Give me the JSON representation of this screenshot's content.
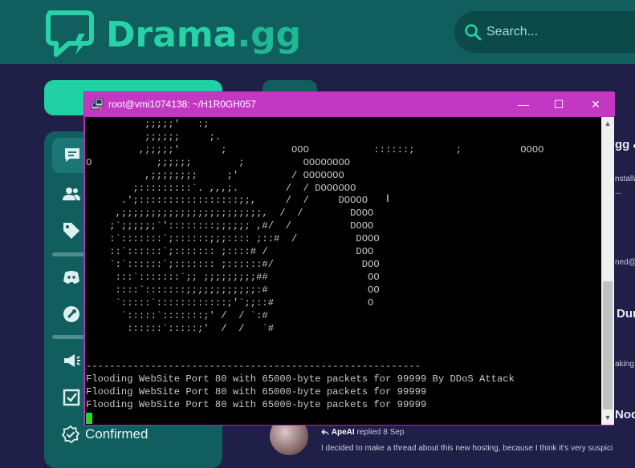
{
  "site": {
    "logo_main": "Drama",
    "logo_tld": ".gg",
    "search_placeholder": "Search..."
  },
  "sidebar": {
    "confirmed_label": "Confirmed"
  },
  "right_fragments": {
    "f1": "gg &",
    "f2": "nstalla",
    "f3": "...",
    "f4": "ned@",
    "f5": "Dun",
    "f6": "aking",
    "f7": "Nod"
  },
  "reply": {
    "user": "ApeAI",
    "text": "replied 8 Sep",
    "preview": "I decided to make a thread about this new hosting, because I think it's very suspici"
  },
  "terminal": {
    "title": "root@vmi1074138: ~/H1R0GH057",
    "minimize": "—",
    "maximize": "☐",
    "close": "✕",
    "lines": [
      "          ;;;;;'   :;",
      "          ;;;;;;     ;.",
      "         ,;;;;;'       ;           OOO           ::::::;       ;          OOOO",
      "O           ;;;;;;        ;          OOOOOOOO",
      "          ,;;;;;;;;     ;'         / OOOOOOO",
      "        ;:::::::::`. ,,,;.        /  / DOOOOOO",
      "      .';:::::::::::::::::;;,     /  /     DOOOO",
      "     ,;;;;;;;;;;;;;;;;;;;;;;;;,  /  /        DOOO",
      "    ;`;;;;;;`'::::::::;;;;;; ,#/  /          DOOO",
      "    :`:::::::`;::::::;;;:::: ;::#  /          DOOO",
      "    ::`::::::`;::::::: ;::::# /               DOO",
      "    `:`::::::`;::::::: ;::::::#/               DOO",
      "     :::`:::::::`;; ;;;;;;;;;##                 OO",
      "     ::::`:::::::;;;;;;;;;;;;:#                 OO",
      "     `:::::`::::::::::::;'`;;::#                O",
      "      `:::::`:::::::;' /  / `:#",
      "       ::::::`:::::;'  /  /   `#",
      "",
      "",
      "---------------------------------------------------------",
      "Flooding WebSite Port 80 with 65000-byte packets for 99999 By DDoS Attack",
      "Flooding WebSite Port 80 with 65000-byte packets for 99999",
      "Flooding WebSite Port 80 with 65000-byte packets for 99999"
    ]
  },
  "colors": {
    "brand": "#27d3a6",
    "header_bg": "#115e5e",
    "page_bg": "#1f1f47",
    "title_bar": "#c338c3",
    "cursor": "#1fdc1f"
  }
}
